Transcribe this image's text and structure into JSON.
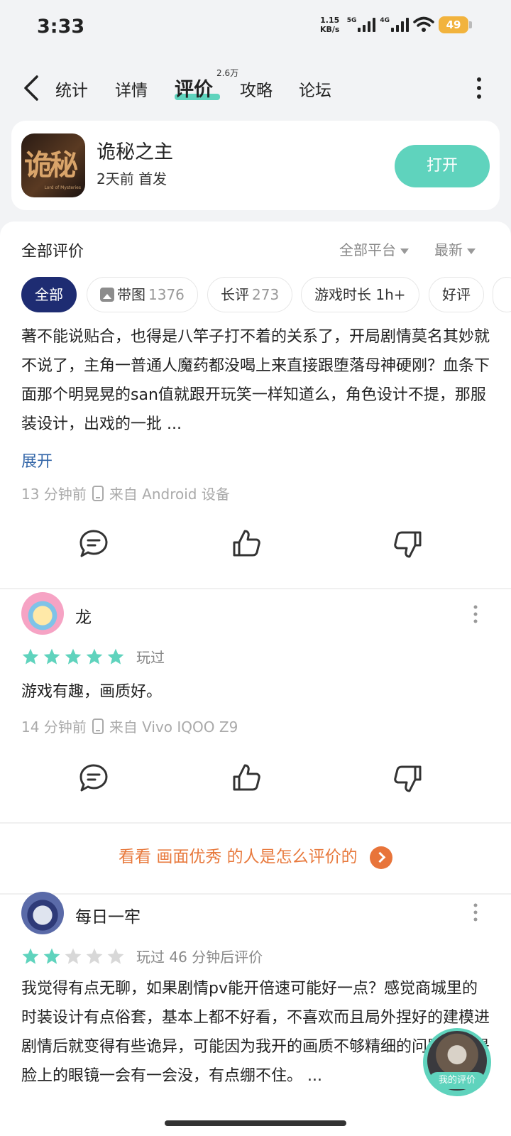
{
  "status_bar": {
    "time": "3:33",
    "speed_value": "1.15",
    "speed_unit": "KB/s",
    "network_1": "5G",
    "network_2": "4G",
    "battery": "49"
  },
  "nav": {
    "tabs": [
      {
        "label": "统计"
      },
      {
        "label": "详情"
      },
      {
        "label": "评价",
        "badge": "2.6万",
        "active": true
      },
      {
        "label": "攻略"
      },
      {
        "label": "论坛"
      }
    ],
    "accent_color": "#5fd3bd"
  },
  "app": {
    "icon": "app-logo-icon",
    "icon_text": "诡秘",
    "icon_subtext": "Lord of Mysteries",
    "name": "诡秘之主",
    "meta": "2天前 首发",
    "open_label": "打开"
  },
  "reviews_section": {
    "title": "全部评价",
    "platform_filter": "全部平台",
    "sort_filter": "最新",
    "chips": [
      {
        "label": "全部",
        "count": "",
        "active": true
      },
      {
        "label": "带图",
        "count": "1376",
        "icon": "image-icon"
      },
      {
        "label": "长评",
        "count": "273"
      },
      {
        "label": "游戏时长 1h+",
        "count": ""
      },
      {
        "label": "好评",
        "count": ""
      }
    ]
  },
  "reviews": [
    {
      "text": "著不能说贴合，也得是八竿子打不着的关系了，开局剧情莫名其妙就不说了，主角一普通人魔药都没喝上来直接跟堕落母神硬刚？血条下面那个明晃晃的san值就跟开玩笑一样知道么，角色设计不提，那服装设计，出戏的一批 ...",
      "expand_label": "展开",
      "time": "13 分钟前",
      "device": "来自 Android 设备"
    },
    {
      "user": "龙",
      "rating": 5,
      "played": "玩过",
      "text": "游戏有趣，画质好。",
      "time": "14 分钟前",
      "device": "来自 Vivo IQOO Z9"
    },
    {
      "user": "每日一牢",
      "rating": 2,
      "played": "玩过 46 分钟后评价",
      "text": "我觉得有点无聊，如果剧情pv能开倍速可能好一点？感觉商城里的时装设计有点俗套，基本上都不好看，不喜欢而且局外捏好的建模进剧情后就变得有些诡异，可能因为我开的画质不够精细的问题，但是脸上的眼镜一会有一会没，有点绷不住。 ..."
    }
  ],
  "prompt": {
    "prefix": "看看",
    "highlight": "画面优秀",
    "suffix": "的人是怎么评价的"
  },
  "floating": {
    "label": "我的评价"
  },
  "colors": {
    "star": "#5fd3bd",
    "star_empty": "#d8d8d8",
    "chip_active": "#1e2c72",
    "prompt": "#e87a3e",
    "link": "#3366a8"
  }
}
